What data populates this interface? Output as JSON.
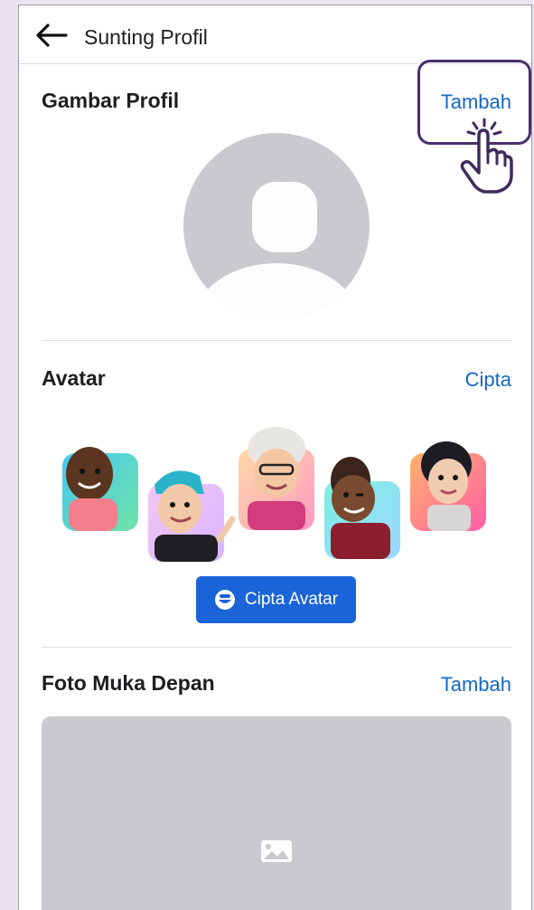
{
  "header": {
    "title": "Sunting Profil"
  },
  "profile_picture": {
    "title": "Gambar Profil",
    "action": "Tambah"
  },
  "avatar": {
    "title": "Avatar",
    "action": "Cipta",
    "button_label": "Cipta Avatar"
  },
  "front_photo": {
    "title": "Foto Muka Depan",
    "action": "Tambah"
  },
  "colors": {
    "accent": "#1666c8",
    "button": "#1a63d8",
    "highlight": "#4a2d6e",
    "placeholder": "#c9c9ce"
  },
  "icons": [
    "back-arrow-icon",
    "profile-silhouette-icon",
    "avatar-icon",
    "image-icon",
    "tap-hand-icon"
  ]
}
